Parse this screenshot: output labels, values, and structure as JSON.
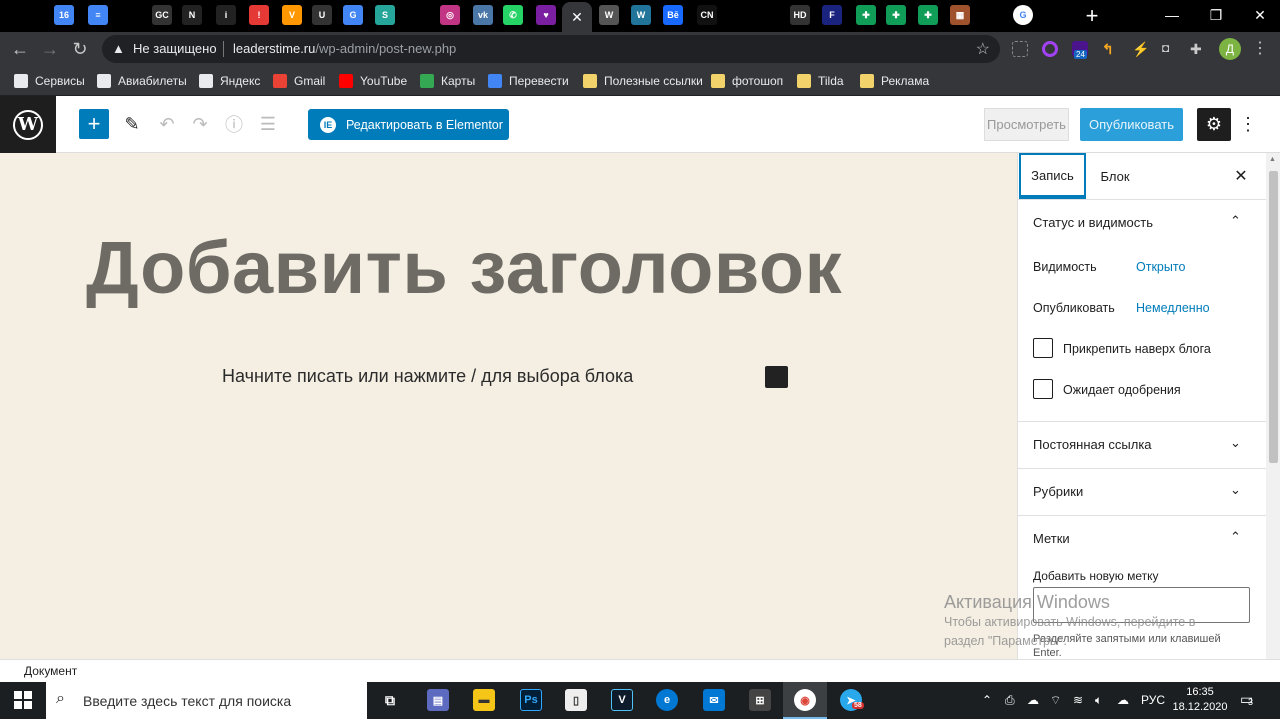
{
  "browser": {
    "tabs": [
      {
        "name": "google-calendar-tab",
        "color": "#4285f4",
        "glyph": "16"
      },
      {
        "name": "google-docs-tab",
        "color": "#4285f4",
        "glyph": "≡"
      },
      {
        "name": "gc-tab",
        "color": "#333333",
        "glyph": "GC"
      },
      {
        "name": "notion-tab",
        "color": "#222222",
        "glyph": "N"
      },
      {
        "name": "info-tab",
        "color": "#222222",
        "glyph": "i"
      },
      {
        "name": "red-tab",
        "color": "#e53935",
        "glyph": "!"
      },
      {
        "name": "orange-tab",
        "color": "#ff9800",
        "glyph": "V"
      },
      {
        "name": "bunny-tab",
        "color": "#333333",
        "glyph": "U"
      },
      {
        "name": "translate-tab",
        "color": "#4285f4",
        "glyph": "G"
      },
      {
        "name": "skype-tab",
        "color": "#26a69a",
        "glyph": "S"
      },
      {
        "name": "instagram-tab",
        "color": "#c13584",
        "glyph": "◎"
      },
      {
        "name": "vk-tab",
        "color": "#4a76a8",
        "glyph": "vk"
      },
      {
        "name": "whatsapp-tab",
        "color": "#25d366",
        "glyph": "✆"
      },
      {
        "name": "heart-tab",
        "color": "#7b1fa2",
        "glyph": "♥"
      },
      {
        "name": "wordpress-tab-1",
        "color": "#555555",
        "glyph": "W"
      },
      {
        "name": "wordpress-tab-2",
        "color": "#21759b",
        "glyph": "W"
      },
      {
        "name": "behance-tab",
        "color": "#1769ff",
        "glyph": "Bē"
      },
      {
        "name": "cn-tab",
        "color": "#111111",
        "glyph": "CN"
      },
      {
        "name": "hd-tab",
        "color": "#333333",
        "glyph": "HD"
      },
      {
        "name": "f-tab",
        "color": "#1a237e",
        "glyph": "F"
      },
      {
        "name": "sheets-tab-1",
        "color": "#0f9d58",
        "glyph": "✚"
      },
      {
        "name": "sheets-tab-2",
        "color": "#0f9d58",
        "glyph": "✚"
      },
      {
        "name": "sheets-tab-3",
        "color": "#0f9d58",
        "glyph": "✚"
      },
      {
        "name": "blocks-tab",
        "color": "#a0522d",
        "glyph": "▦"
      },
      {
        "name": "google-tab",
        "color": "#ffffff",
        "glyph": "G"
      }
    ],
    "insecure_label": "Не защищено",
    "url_host": "leaderstime.ru",
    "url_path": "/wp-admin/post-new.php",
    "profile_initial": "Д",
    "ext_badge": "24",
    "bookmarks": [
      {
        "label": "Сервисы",
        "color": "#e8eaed"
      },
      {
        "label": "Авиабилеты",
        "color": "#e8eaed"
      },
      {
        "label": "Яндекс",
        "color": "#e8eaed"
      },
      {
        "label": "Gmail",
        "color": "#ea4335"
      },
      {
        "label": "YouTube",
        "color": "#ff0000"
      },
      {
        "label": "Карты",
        "color": "#34a853"
      },
      {
        "label": "Перевести",
        "color": "#4285f4"
      },
      {
        "label": "Полезные ссылки",
        "color": "#f2d36b"
      },
      {
        "label": "фотошоп",
        "color": "#f2d36b"
      },
      {
        "label": "Tilda",
        "color": "#f2d36b"
      },
      {
        "label": "Реклама",
        "color": "#f2d36b"
      }
    ]
  },
  "editor": {
    "elementor_label": "Редактировать в Elementor",
    "preview_label": "Просмотреть",
    "publish_label": "Опубликовать",
    "title_placeholder": "Добавить заголовок",
    "paragraph_placeholder": "Начните писать или нажмите / для выбора блока",
    "footer_label": "Документ"
  },
  "sidebar": {
    "tab_post": "Запись",
    "tab_block": "Блок",
    "status_title": "Статус и видимость",
    "visibility_label": "Видимость",
    "visibility_value": "Открыто",
    "publish_label": "Опубликовать",
    "publish_value": "Немедленно",
    "sticky_label": "Прикрепить наверх блога",
    "pending_label": "Ожидает одобрения",
    "permalink_title": "Постоянная ссылка",
    "categories_title": "Рубрики",
    "tags_title": "Метки",
    "add_tag_label": "Добавить новую метку",
    "tag_hint": "Разделяйте запятыми или клавишей Enter."
  },
  "watermark": {
    "title": "Активация Windows",
    "line1": "Чтобы активировать Windows, перейдите в",
    "line2": "раздел \"Параметры\"."
  },
  "taskbar": {
    "search_placeholder": "Введите здесь текст для поиска",
    "lang": "РУС",
    "time": "16:35",
    "date": "18.12.2020",
    "notifications": "3",
    "telegram_badge": "58"
  }
}
